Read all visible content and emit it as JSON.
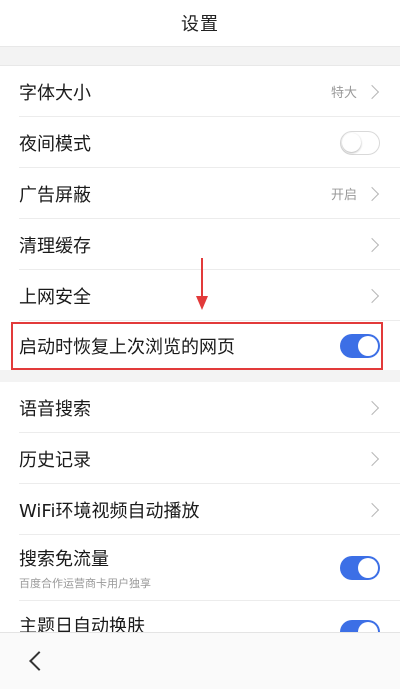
{
  "header": {
    "title": "设置"
  },
  "settings": {
    "font_size": {
      "label": "字体大小",
      "value": "特大"
    },
    "night_mode": {
      "label": "夜间模式",
      "on": false
    },
    "ad_block": {
      "label": "广告屏蔽",
      "value": "开启"
    },
    "clear_cache": {
      "label": "清理缓存"
    },
    "web_security": {
      "label": "上网安全"
    },
    "restore_pages": {
      "label": "启动时恢复上次浏览的网页",
      "on": true
    },
    "voice_search": {
      "label": "语音搜索"
    },
    "history": {
      "label": "历史记录"
    },
    "wifi_autoplay": {
      "label": "WiFi环境视频自动播放"
    },
    "search_free_data": {
      "label": "搜索免流量",
      "sublabel": "百度合作运营商卡用户独享",
      "on": true
    },
    "theme_auto_skin": {
      "label": "主题日自动换肤",
      "on": true
    }
  },
  "colors": {
    "accent": "#3c6fe6",
    "annotation": "#e23a3a"
  },
  "icons": {
    "chevron": "chevron-right-icon",
    "back": "back-arrow-icon"
  }
}
